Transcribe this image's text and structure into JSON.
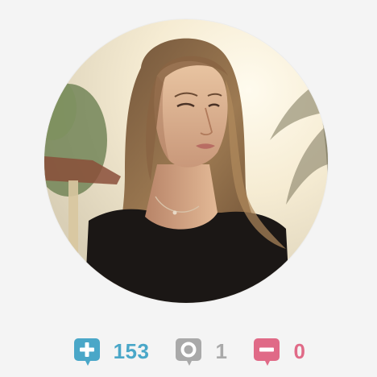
{
  "profile": {
    "avatar_icon": "person-photo",
    "stats": {
      "positive": {
        "count": "153",
        "icon": "plus-bubble-icon",
        "color": "#4aa7c8"
      },
      "neutral": {
        "count": "1",
        "icon": "circle-bubble-icon",
        "color": "#a9a9a9"
      },
      "negative": {
        "count": "0",
        "icon": "minus-bubble-icon",
        "color": "#e06a87"
      }
    }
  }
}
